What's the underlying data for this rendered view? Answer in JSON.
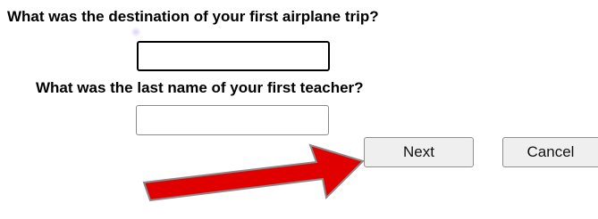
{
  "questions": [
    {
      "label": "What was the destination of your first airplane trip?",
      "value": "",
      "placeholder": ""
    },
    {
      "label": "What was the last name of your first teacher?",
      "value": "",
      "placeholder": ""
    }
  ],
  "buttons": {
    "next_label": "Next",
    "cancel_label": "Cancel"
  },
  "colors": {
    "arrow_fill": "#e00000",
    "arrow_outline": "#8a8a8a",
    "button_bg": "#efefef"
  },
  "annotation": {
    "arrow_icon": "red-pointer-arrow-icon",
    "points_to": "next-button"
  }
}
